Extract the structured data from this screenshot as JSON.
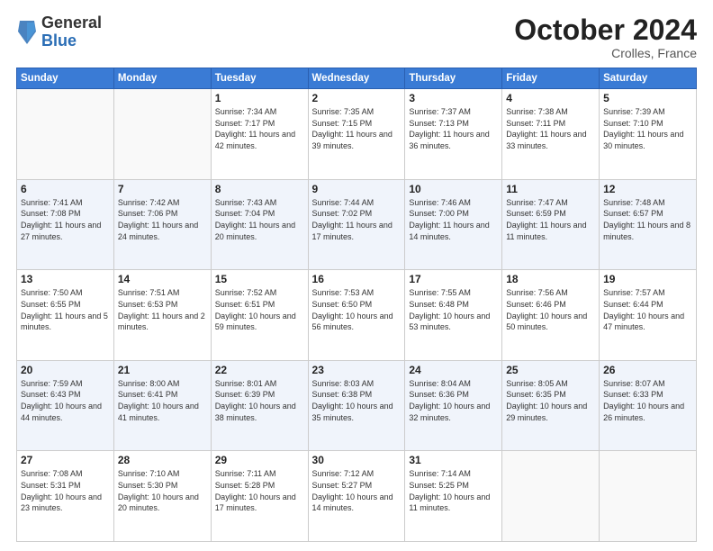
{
  "header": {
    "logo_general": "General",
    "logo_blue": "Blue",
    "month_title": "October 2024",
    "location": "Crolles, France"
  },
  "days_of_week": [
    "Sunday",
    "Monday",
    "Tuesday",
    "Wednesday",
    "Thursday",
    "Friday",
    "Saturday"
  ],
  "weeks": [
    [
      {
        "day": "",
        "detail": ""
      },
      {
        "day": "",
        "detail": ""
      },
      {
        "day": "1",
        "detail": "Sunrise: 7:34 AM\nSunset: 7:17 PM\nDaylight: 11 hours and 42 minutes."
      },
      {
        "day": "2",
        "detail": "Sunrise: 7:35 AM\nSunset: 7:15 PM\nDaylight: 11 hours and 39 minutes."
      },
      {
        "day": "3",
        "detail": "Sunrise: 7:37 AM\nSunset: 7:13 PM\nDaylight: 11 hours and 36 minutes."
      },
      {
        "day": "4",
        "detail": "Sunrise: 7:38 AM\nSunset: 7:11 PM\nDaylight: 11 hours and 33 minutes."
      },
      {
        "day": "5",
        "detail": "Sunrise: 7:39 AM\nSunset: 7:10 PM\nDaylight: 11 hours and 30 minutes."
      }
    ],
    [
      {
        "day": "6",
        "detail": "Sunrise: 7:41 AM\nSunset: 7:08 PM\nDaylight: 11 hours and 27 minutes."
      },
      {
        "day": "7",
        "detail": "Sunrise: 7:42 AM\nSunset: 7:06 PM\nDaylight: 11 hours and 24 minutes."
      },
      {
        "day": "8",
        "detail": "Sunrise: 7:43 AM\nSunset: 7:04 PM\nDaylight: 11 hours and 20 minutes."
      },
      {
        "day": "9",
        "detail": "Sunrise: 7:44 AM\nSunset: 7:02 PM\nDaylight: 11 hours and 17 minutes."
      },
      {
        "day": "10",
        "detail": "Sunrise: 7:46 AM\nSunset: 7:00 PM\nDaylight: 11 hours and 14 minutes."
      },
      {
        "day": "11",
        "detail": "Sunrise: 7:47 AM\nSunset: 6:59 PM\nDaylight: 11 hours and 11 minutes."
      },
      {
        "day": "12",
        "detail": "Sunrise: 7:48 AM\nSunset: 6:57 PM\nDaylight: 11 hours and 8 minutes."
      }
    ],
    [
      {
        "day": "13",
        "detail": "Sunrise: 7:50 AM\nSunset: 6:55 PM\nDaylight: 11 hours and 5 minutes."
      },
      {
        "day": "14",
        "detail": "Sunrise: 7:51 AM\nSunset: 6:53 PM\nDaylight: 11 hours and 2 minutes."
      },
      {
        "day": "15",
        "detail": "Sunrise: 7:52 AM\nSunset: 6:51 PM\nDaylight: 10 hours and 59 minutes."
      },
      {
        "day": "16",
        "detail": "Sunrise: 7:53 AM\nSunset: 6:50 PM\nDaylight: 10 hours and 56 minutes."
      },
      {
        "day": "17",
        "detail": "Sunrise: 7:55 AM\nSunset: 6:48 PM\nDaylight: 10 hours and 53 minutes."
      },
      {
        "day": "18",
        "detail": "Sunrise: 7:56 AM\nSunset: 6:46 PM\nDaylight: 10 hours and 50 minutes."
      },
      {
        "day": "19",
        "detail": "Sunrise: 7:57 AM\nSunset: 6:44 PM\nDaylight: 10 hours and 47 minutes."
      }
    ],
    [
      {
        "day": "20",
        "detail": "Sunrise: 7:59 AM\nSunset: 6:43 PM\nDaylight: 10 hours and 44 minutes."
      },
      {
        "day": "21",
        "detail": "Sunrise: 8:00 AM\nSunset: 6:41 PM\nDaylight: 10 hours and 41 minutes."
      },
      {
        "day": "22",
        "detail": "Sunrise: 8:01 AM\nSunset: 6:39 PM\nDaylight: 10 hours and 38 minutes."
      },
      {
        "day": "23",
        "detail": "Sunrise: 8:03 AM\nSunset: 6:38 PM\nDaylight: 10 hours and 35 minutes."
      },
      {
        "day": "24",
        "detail": "Sunrise: 8:04 AM\nSunset: 6:36 PM\nDaylight: 10 hours and 32 minutes."
      },
      {
        "day": "25",
        "detail": "Sunrise: 8:05 AM\nSunset: 6:35 PM\nDaylight: 10 hours and 29 minutes."
      },
      {
        "day": "26",
        "detail": "Sunrise: 8:07 AM\nSunset: 6:33 PM\nDaylight: 10 hours and 26 minutes."
      }
    ],
    [
      {
        "day": "27",
        "detail": "Sunrise: 7:08 AM\nSunset: 5:31 PM\nDaylight: 10 hours and 23 minutes."
      },
      {
        "day": "28",
        "detail": "Sunrise: 7:10 AM\nSunset: 5:30 PM\nDaylight: 10 hours and 20 minutes."
      },
      {
        "day": "29",
        "detail": "Sunrise: 7:11 AM\nSunset: 5:28 PM\nDaylight: 10 hours and 17 minutes."
      },
      {
        "day": "30",
        "detail": "Sunrise: 7:12 AM\nSunset: 5:27 PM\nDaylight: 10 hours and 14 minutes."
      },
      {
        "day": "31",
        "detail": "Sunrise: 7:14 AM\nSunset: 5:25 PM\nDaylight: 10 hours and 11 minutes."
      },
      {
        "day": "",
        "detail": ""
      },
      {
        "day": "",
        "detail": ""
      }
    ]
  ]
}
